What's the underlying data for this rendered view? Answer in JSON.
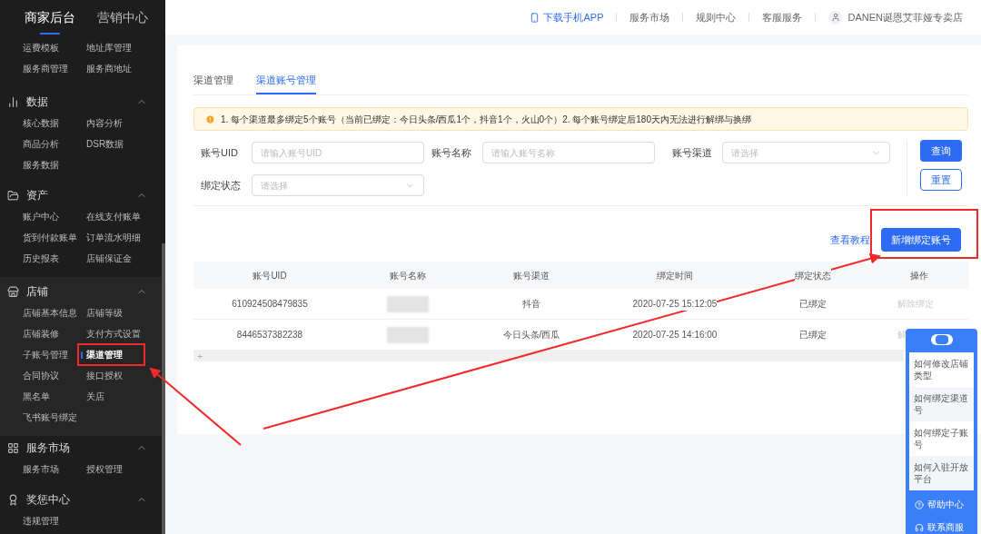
{
  "sidebar": {
    "tabs": [
      {
        "label": "商家后台",
        "selected": true
      },
      {
        "label": "营销中心",
        "selected": false
      }
    ],
    "sections": [
      {
        "items": [
          {
            "label": "运费模板",
            "selected": false
          },
          {
            "label": "地址库管理",
            "selected": false
          },
          {
            "label": "服务商管理",
            "selected": false
          },
          {
            "label": "服务商地址",
            "selected": false
          }
        ]
      },
      {
        "title": "数据",
        "expanded": true,
        "items": [
          {
            "label": "核心数据",
            "selected": false
          },
          {
            "label": "内容分析",
            "selected": false
          },
          {
            "label": "商品分析",
            "selected": false
          },
          {
            "label": "DSR数据",
            "selected": false
          },
          {
            "label": "服务数据",
            "selected": false
          }
        ]
      },
      {
        "title": "资产",
        "expanded": true,
        "items": [
          {
            "label": "账户中心",
            "selected": false
          },
          {
            "label": "在线支付账单",
            "selected": false
          },
          {
            "label": "货到付款账单",
            "selected": false
          },
          {
            "label": "订单流水明细",
            "selected": false
          },
          {
            "label": "历史报表",
            "selected": false
          },
          {
            "label": "店铺保证金",
            "selected": false
          }
        ]
      },
      {
        "title": "店铺",
        "expanded": true,
        "items": [
          {
            "label": "店铺基本信息",
            "selected": false
          },
          {
            "label": "店铺等级",
            "selected": false
          },
          {
            "label": "店铺装修",
            "selected": false
          },
          {
            "label": "支付方式设置",
            "selected": false
          },
          {
            "label": "子账号管理",
            "selected": false
          },
          {
            "label": "渠道管理",
            "selected": true
          },
          {
            "label": "合同协议",
            "selected": false
          },
          {
            "label": "接口授权",
            "selected": false
          },
          {
            "label": "黑名单",
            "selected": false
          },
          {
            "label": "关店",
            "selected": false
          },
          {
            "label": "飞书账号绑定",
            "selected": false
          }
        ]
      },
      {
        "title": "服务市场",
        "expanded": true,
        "items": [
          {
            "label": "服务市场",
            "selected": false
          },
          {
            "label": "授权管理",
            "selected": false
          }
        ]
      },
      {
        "title": "奖惩中心",
        "expanded": true,
        "items": [
          {
            "label": "违规管理",
            "selected": false
          }
        ]
      }
    ]
  },
  "header": {
    "app_link": "下载手机APP",
    "links": [
      "服务市场",
      "规则中心",
      "客服服务"
    ],
    "shop": "DANEN诞恩艾菲娅专卖店"
  },
  "tabs": [
    {
      "label": "渠道管理",
      "selected": false
    },
    {
      "label": "渠道账号管理",
      "selected": true
    }
  ],
  "notice": "1. 每个渠道最多绑定5个账号（当前已绑定：今日头条/西瓜1个，抖音1个，火山0个）2. 每个账号绑定后180天内无法进行解绑与换绑",
  "filters": [
    {
      "kind": "input",
      "label": "账号UID",
      "placeholder": "请输入账号UID"
    },
    {
      "kind": "input",
      "label": "账号名称",
      "placeholder": "请输入账号名称"
    },
    {
      "kind": "select",
      "label": "账号渠道",
      "placeholder": "请选择"
    },
    {
      "kind": "select",
      "label": "绑定状态",
      "placeholder": "请选择"
    }
  ],
  "buttons": {
    "query": "查询",
    "reset": "重置",
    "tutorial": "查看教程",
    "add": "新增绑定账号"
  },
  "table": {
    "columns": [
      "账号UID",
      "账号名称",
      "账号渠道",
      "绑定时间",
      "绑定状态",
      "操作"
    ],
    "rows": [
      {
        "uid": "610924508479835",
        "channel": "抖音",
        "time": "2020-07-25 15:12:05",
        "status": "已绑定",
        "action": "解除绑定"
      },
      {
        "uid": "8446537382238",
        "channel": "今日头条/西瓜",
        "time": "2020-07-25 14:16:00",
        "status": "已绑定",
        "action": "解"
      }
    ]
  },
  "help": {
    "questions": [
      "如何修改店铺类型",
      "如何绑定渠道号",
      "如何绑定子账号",
      "如何入驻开放平台"
    ],
    "footer": [
      "帮助中心",
      "联系商服"
    ]
  }
}
